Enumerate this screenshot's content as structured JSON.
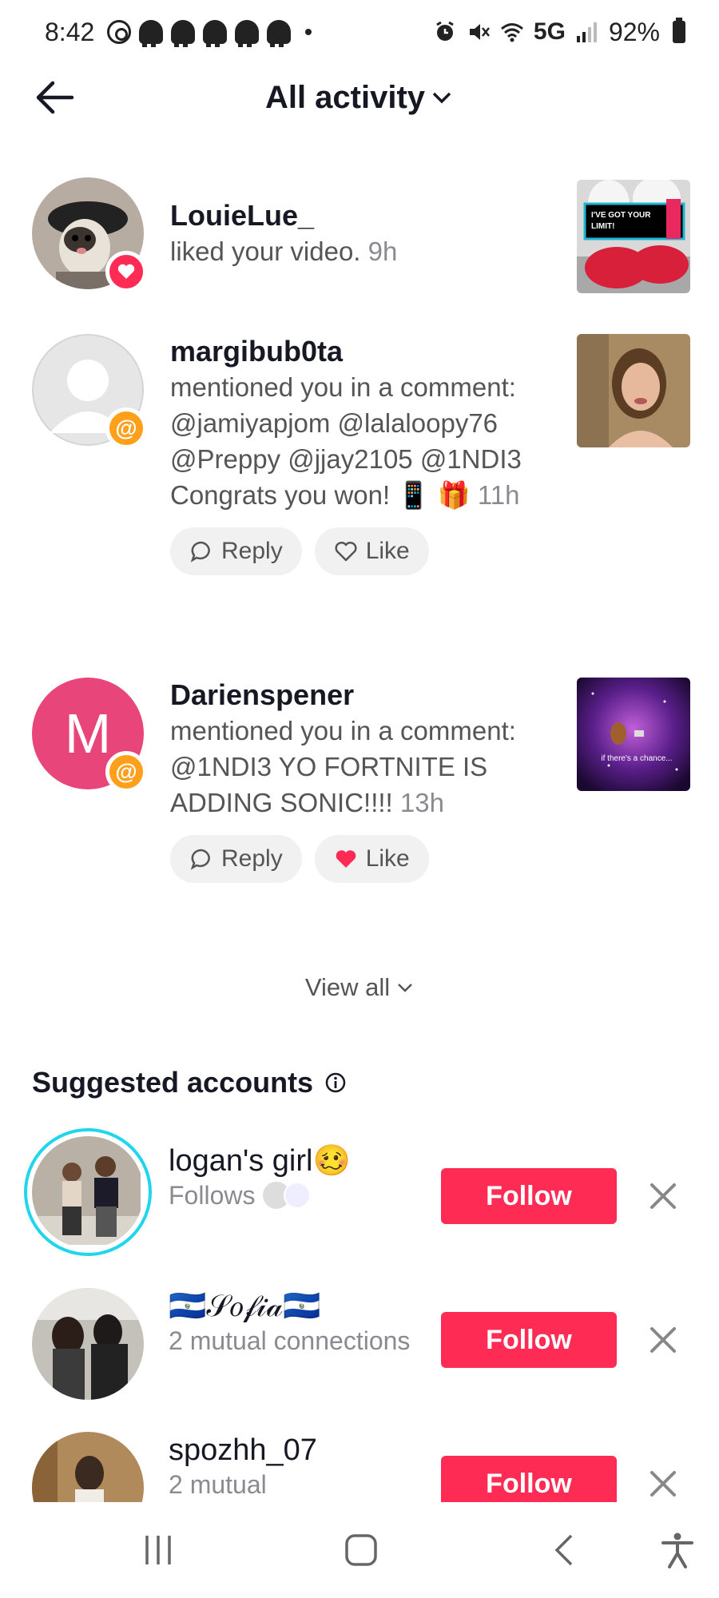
{
  "status_bar": {
    "time": "8:42",
    "network": "5G",
    "battery": "92%"
  },
  "header": {
    "title": "All activity"
  },
  "notifications": [
    {
      "user": "LouieLue_",
      "text": "liked your video.",
      "time": "9h"
    },
    {
      "user": "margibub0ta",
      "text": "mentioned you in a comment: @jamiyapjom @lalaloopy76 @Preppy @jjay2105 @1NDI3 Congrats you won! 📱 🎁",
      "time": "11h",
      "reply_label": "Reply",
      "like_label": "Like"
    },
    {
      "user": "Darienspener",
      "avatar_letter": "M",
      "text": "mentioned you in a comment: @1NDI3 YO FORTNITE IS ADDING SONIC!!!!",
      "time": "13h",
      "reply_label": "Reply",
      "like_label": "Like",
      "liked": true
    }
  ],
  "thumbs": {
    "t1": "I'VE GOT YOUR LIMIT!",
    "t3": "if there's a chance..."
  },
  "view_all": "View all",
  "suggested": {
    "title": "Suggested accounts",
    "accounts": [
      {
        "name": "logan's girl🥴",
        "sub": "Follows",
        "follow": "Follow"
      },
      {
        "name": "🇸🇻𝒮𝑜𝒻𝒾𝒶🇸🇻",
        "sub": "2 mutual connections",
        "follow": "Follow"
      },
      {
        "name": "spozhh_07",
        "sub": "2 mutual",
        "follow": "Follow"
      }
    ]
  },
  "colors": {
    "accent": "#fe2c55",
    "mention": "#ff9f1a",
    "ring": "#20d5ec"
  }
}
